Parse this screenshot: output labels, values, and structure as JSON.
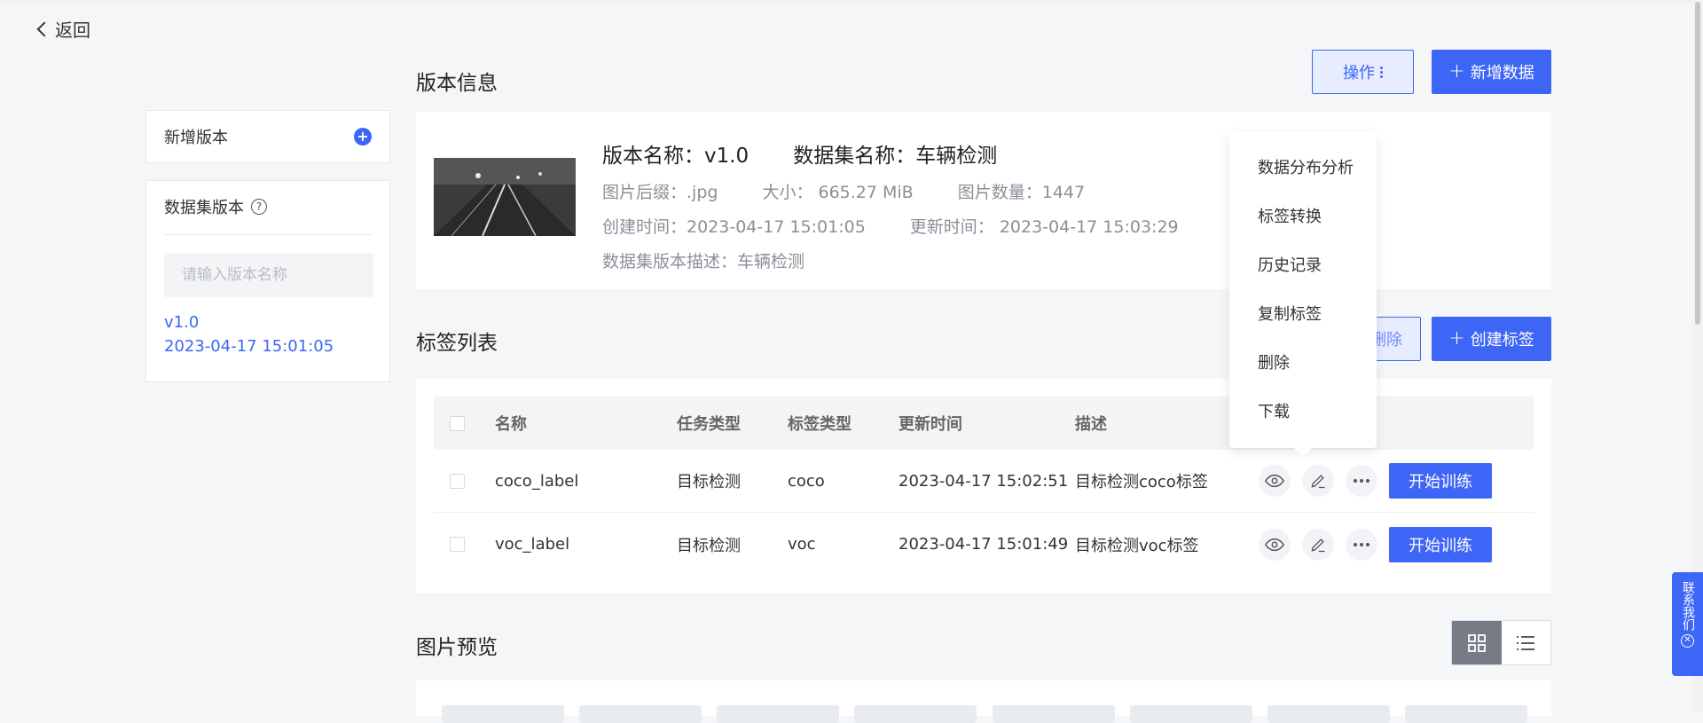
{
  "nav": {
    "back_label": "返回"
  },
  "sidebar": {
    "add_version_label": "新增版本",
    "dataset_versions_title": "数据集版本",
    "search_placeholder": "请输入版本名称",
    "versions": [
      {
        "name": "v1.0",
        "time": "2023-04-17 15:01:05"
      }
    ]
  },
  "version_info": {
    "title": "版本信息",
    "operate_label": "操作",
    "add_data_label": "新增数据",
    "version_name": "版本名称：v1.0",
    "dataset_name": "数据集名称：车辆检测",
    "suffix": "图片后缀：.jpg",
    "size": "大小： 665.27 MiB",
    "image_count": "图片数量：1447",
    "created": "创建时间：2023-04-17 15:01:05",
    "updated": "更新时间： 2023-04-17 15:03:29",
    "description": "数据集版本描述：车辆检测"
  },
  "dropdown": {
    "items": [
      "数据分布分析",
      "标签转换",
      "历史记录",
      "复制标签",
      "删除",
      "下载"
    ]
  },
  "labels": {
    "title": "标签列表",
    "delete_label": "删除",
    "create_label": "创建标签",
    "columns": [
      "名称",
      "任务类型",
      "标签类型",
      "更新时间",
      "描述"
    ],
    "rows": [
      {
        "name": "coco_label",
        "task": "目标检测",
        "type": "coco",
        "time": "2023-04-17 15:02:51",
        "desc": "目标检测coco标签"
      },
      {
        "name": "voc_label",
        "task": "目标检测",
        "type": "voc",
        "time": "2023-04-17 15:01:49",
        "desc": "目标检测voc标签"
      }
    ],
    "train_label": "开始训练"
  },
  "preview": {
    "title": "图片预览"
  },
  "contact": {
    "label": "联系我们"
  },
  "colors": {
    "primary": "#3e66f6",
    "background": "#f5f6f8"
  }
}
